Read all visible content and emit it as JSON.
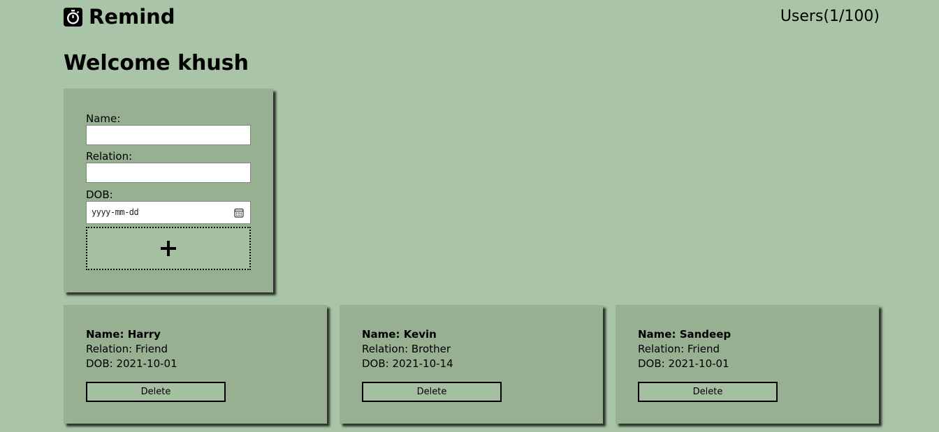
{
  "header": {
    "app_title": "Remind",
    "users_count": "Users(1/100)",
    "logo_icon": "stopwatch-icon"
  },
  "welcome": "Welcome khush",
  "form": {
    "name_label": "Name:",
    "name_value": "",
    "relation_label": "Relation:",
    "relation_value": "",
    "dob_label": "DOB:",
    "dob_placeholder": "yyyy-mm-dd",
    "add_icon": "plus-icon"
  },
  "entries": [
    {
      "name": "Name: Harry",
      "relation": "Relation: Friend",
      "dob": "DOB: 2021-10-01",
      "delete_label": "Delete"
    },
    {
      "name": "Name: Kevin",
      "relation": "Relation: Brother",
      "dob": "DOB: 2021-10-14",
      "delete_label": "Delete"
    },
    {
      "name": "Name: Sandeep",
      "relation": "Relation: Friend",
      "dob": "DOB: 2021-10-01",
      "delete_label": "Delete"
    }
  ],
  "colors": {
    "background": "#a9c4a6",
    "card": "#97b092",
    "button": "#a5bfa1"
  }
}
